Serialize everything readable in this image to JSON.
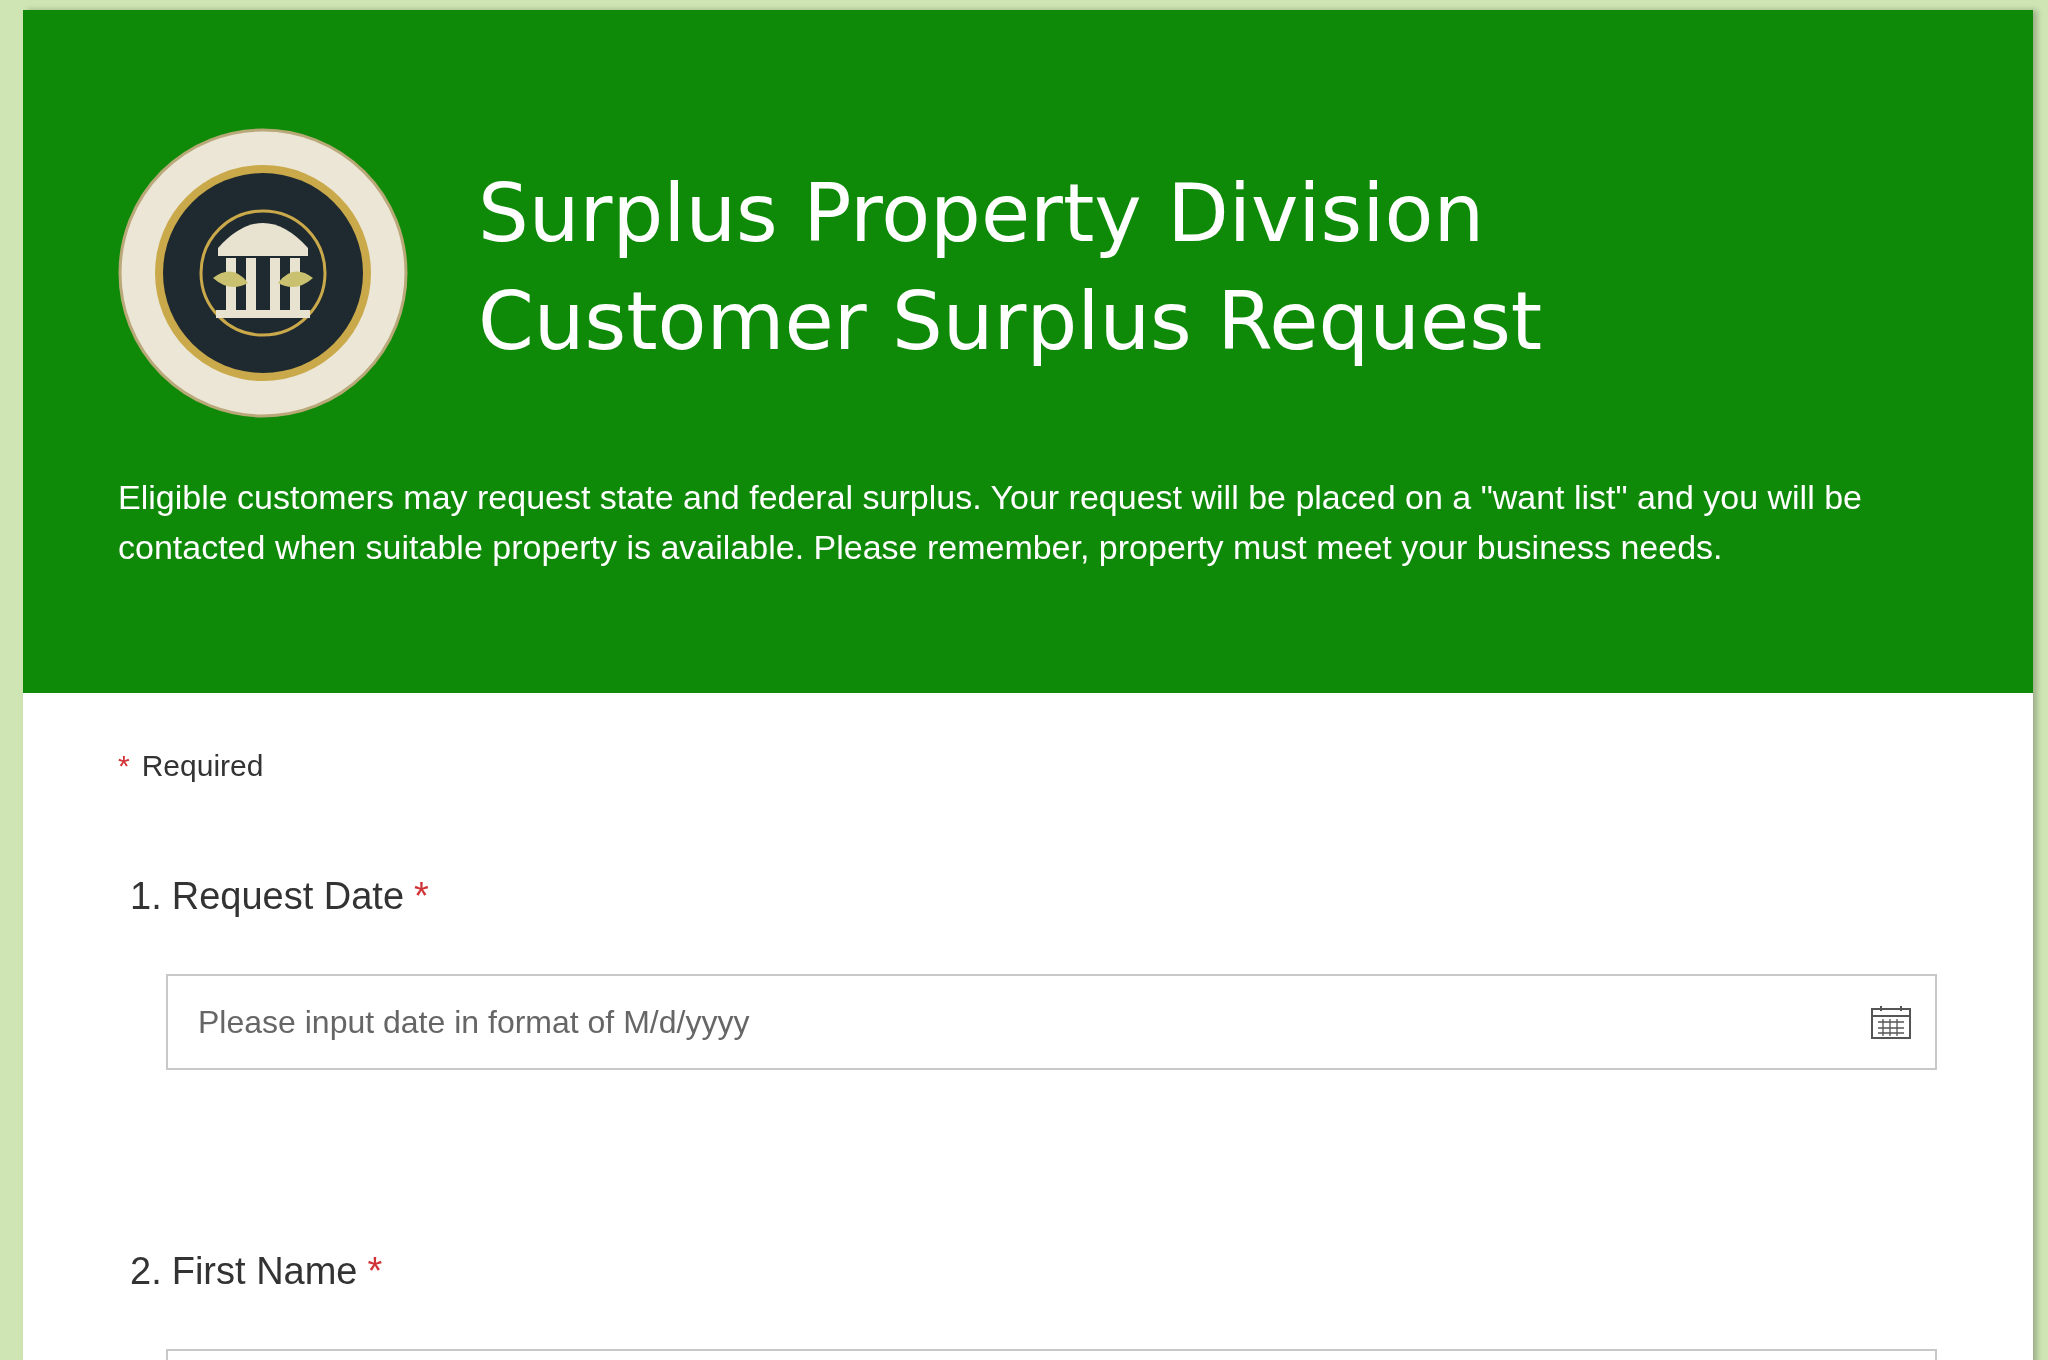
{
  "header": {
    "title_lines": [
      "Surplus Property Division",
      "Customer Surplus Request"
    ],
    "description": "Eligible customers may request state and federal surplus.  Your request will be placed on a \"want list\" and you will be contacted when suitable property is available.  Please remember, property must meet your business needs."
  },
  "required_note": {
    "mark": "*",
    "label": "Required"
  },
  "questions": [
    {
      "number": "1.",
      "label": "Request Date",
      "required": true,
      "kind": "date",
      "placeholder": "Please input date in format of M/d/yyyy"
    },
    {
      "number": "2.",
      "label": "First Name",
      "required": true,
      "kind": "text"
    }
  ]
}
